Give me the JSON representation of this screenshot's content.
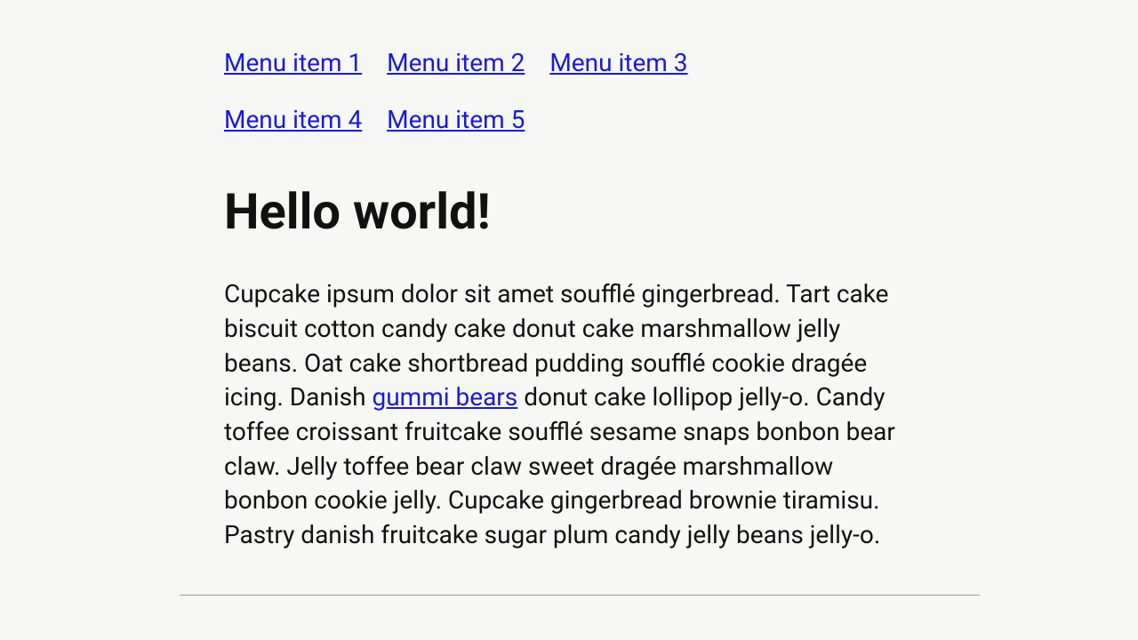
{
  "nav": {
    "items": [
      {
        "label": "Menu item 1"
      },
      {
        "label": "Menu item 2"
      },
      {
        "label": "Menu item 3"
      },
      {
        "label": "Menu item 4"
      },
      {
        "label": "Menu item 5"
      }
    ]
  },
  "main": {
    "heading": "Hello world!",
    "paragraph_before_link": "Cupcake ipsum dolor sit amet soufflé gingerbread. Tart cake biscuit cotton candy cake donut cake marshmallow jelly beans. Oat cake shortbread pudding soufflé cookie dragée icing. Danish ",
    "link_text": "gummi bears",
    "paragraph_after_link": " donut cake lollipop jelly-o. Candy toffee croissant fruitcake soufflé sesame snaps bonbon bear claw. Jelly toffee bear claw sweet dragée marshmallow bonbon cookie jelly. Cupcake gingerbread brownie tiramisu. Pastry danish fruitcake sugar plum candy jelly beans jelly-o."
  }
}
